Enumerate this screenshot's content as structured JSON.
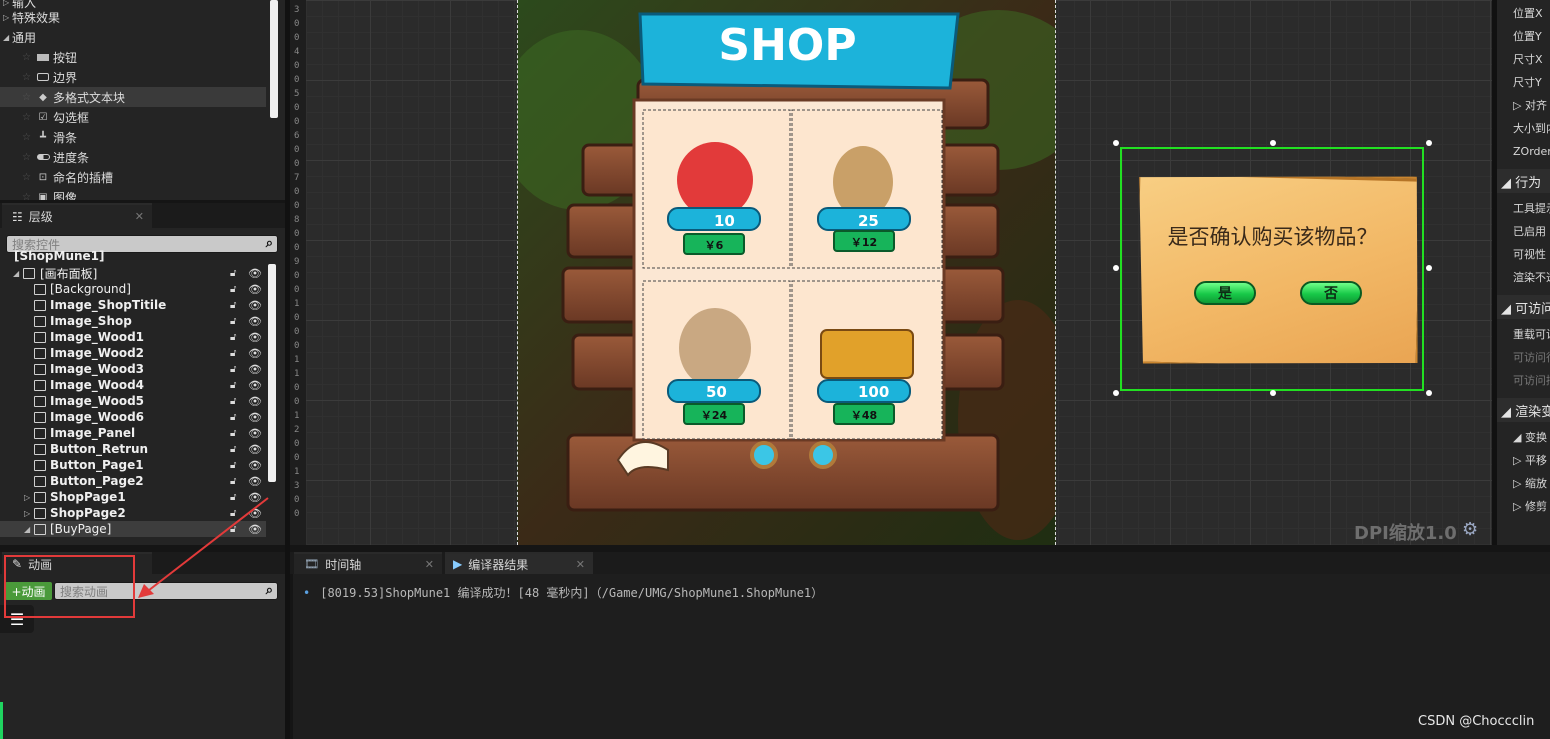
{
  "palette": {
    "categories": [
      {
        "label": "输入",
        "expanded": false
      },
      {
        "label": "特殊效果",
        "expanded": false
      },
      {
        "label": "通用",
        "expanded": true
      }
    ],
    "items": [
      {
        "label": "按钮",
        "icon": "button-widget-icon"
      },
      {
        "label": "边界",
        "icon": "border-widget-icon"
      },
      {
        "label": "多格式文本块",
        "icon": "rich-text-icon"
      },
      {
        "label": "勾选框",
        "icon": "checkbox-icon"
      },
      {
        "label": "滑条",
        "icon": "slider-icon"
      },
      {
        "label": "进度条",
        "icon": "progress-bar-icon"
      },
      {
        "label": "命名的插槽",
        "icon": "named-slot-icon"
      },
      {
        "label": "图像",
        "icon": "image-widget-icon"
      }
    ]
  },
  "hierarchy": {
    "tab_label": "层级",
    "search_placeholder": "搜索控件",
    "root": "[ShopMune1]",
    "canvas_panel": "[画布面板]",
    "rows": [
      {
        "label": "[Background]",
        "bold": false
      },
      {
        "label": "Image_ShopTitile",
        "bold": true
      },
      {
        "label": "Image_Shop",
        "bold": true
      },
      {
        "label": "Image_Wood1",
        "bold": true
      },
      {
        "label": "Image_Wood2",
        "bold": true
      },
      {
        "label": "Image_Wood3",
        "bold": true
      },
      {
        "label": "Image_Wood4",
        "bold": true
      },
      {
        "label": "Image_Wood5",
        "bold": true
      },
      {
        "label": "Image_Wood6",
        "bold": true
      },
      {
        "label": "Image_Panel",
        "bold": true
      },
      {
        "label": "Button_Retrun",
        "bold": true
      },
      {
        "label": "Button_Page1",
        "bold": true
      },
      {
        "label": "Button_Page2",
        "bold": true
      },
      {
        "label": "ShopPage1",
        "bold": true
      },
      {
        "label": "ShopPage2",
        "bold": true
      },
      {
        "label": "[BuyPage]",
        "bold": false
      }
    ]
  },
  "animation": {
    "tab_label": "动画",
    "add_button": "+动画",
    "search_placeholder": "搜索动画"
  },
  "ruler_labels": [
    "3",
    "0",
    "0",
    "4",
    "0",
    "0",
    "5",
    "0",
    "0",
    "6",
    "0",
    "0",
    "7",
    "0",
    "0",
    "8",
    "0",
    "0",
    "9",
    "0",
    "0",
    "1",
    "0",
    "0",
    "0",
    "1",
    "1",
    "0",
    "0",
    "1",
    "2",
    "0",
    "0",
    "1",
    "3",
    "0",
    "0"
  ],
  "shop": {
    "title": "SHOP",
    "items": [
      {
        "gems": "10",
        "price": "￥6"
      },
      {
        "gems": "25",
        "price": "￥12"
      },
      {
        "gems": "50",
        "price": "￥24"
      },
      {
        "gems": "100",
        "price": "￥48"
      }
    ]
  },
  "confirm": {
    "question": "是否确认购买该物品？",
    "yes": "是",
    "no": "否"
  },
  "dpi_label": "DPI缩放1.0",
  "details": {
    "rows": [
      {
        "type": "row",
        "label": "位置X"
      },
      {
        "type": "row",
        "label": "位置Y"
      },
      {
        "type": "row",
        "label": "尺寸X"
      },
      {
        "type": "row",
        "label": "尺寸Y"
      },
      {
        "type": "row",
        "label": "▷ 对齐"
      },
      {
        "type": "row",
        "label": "大小到内容"
      },
      {
        "type": "row",
        "label": "ZOrder"
      },
      {
        "type": "section",
        "label": "◢ 行为"
      },
      {
        "type": "row",
        "label": "工具提示"
      },
      {
        "type": "row",
        "label": "已启用"
      },
      {
        "type": "row",
        "label": "可视性"
      },
      {
        "type": "row",
        "label": "渲染不透明"
      },
      {
        "type": "section",
        "label": "◢ 可访问性"
      },
      {
        "type": "row",
        "label": "重载可访问"
      },
      {
        "type": "dim",
        "label": "可访问行为"
      },
      {
        "type": "dim",
        "label": "可访问摘要"
      },
      {
        "type": "section",
        "label": "◢ 渲染变换"
      },
      {
        "type": "row",
        "label": "◢ 变换"
      },
      {
        "type": "row",
        "label": "▷ 平移"
      },
      {
        "type": "row",
        "label": "▷ 缩放"
      },
      {
        "type": "row",
        "label": "▷ 修剪"
      }
    ]
  },
  "bottom": {
    "tab_timeline": "时间轴",
    "tab_compiler": "编译器结果",
    "log": "[8019.53]ShopMune1 编译成功！[48 毫秒内]（/Game/UMG/ShopMune1.ShopMune1）"
  },
  "watermark": "CSDN @Choccclin"
}
